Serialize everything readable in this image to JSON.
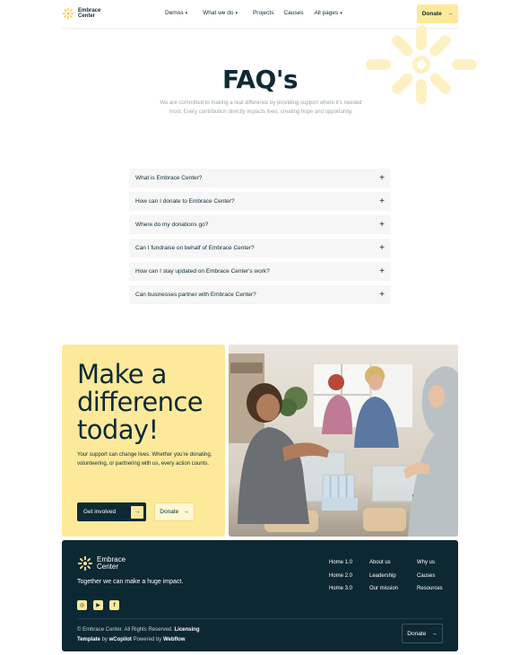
{
  "nav": {
    "logo_text": "Embrace Center",
    "menu": [
      {
        "label": "Demos",
        "caret": "▾"
      },
      {
        "label": "What we do",
        "caret": "▾"
      },
      {
        "label": "Projects",
        "caret": ""
      },
      {
        "label": "Causes",
        "caret": ""
      },
      {
        "label": "All pages",
        "caret": "▾"
      }
    ],
    "donate_label": "Donate",
    "arrow": "→"
  },
  "hero": {
    "title": "FAQ's",
    "subtitle": "We are committed to making a real difference by providing support where it's needed most. Every contribution directly impacts lives, creating hope and opportunity."
  },
  "faq": {
    "items": [
      {
        "question": "What is Embrace Center?"
      },
      {
        "question": "How can I donate to Embrace Center?"
      },
      {
        "question": "Where do my donations go?"
      },
      {
        "question": "Can I fundraise on behalf of Embrace Center?"
      },
      {
        "question": "How can I stay updated on Embrace Center's work?"
      },
      {
        "question": "Can businesses partner with Embrace Center?"
      }
    ],
    "expand_icon": "+"
  },
  "cta": {
    "heading_line1": "Make a",
    "heading_line2": "difference",
    "heading_line3": "today!",
    "text": "Your support can change lives. Whether you're donating, volunteering, or partnering with us, every action counts.",
    "primary_label": "Get involved",
    "secondary_label": "Donate",
    "arrow": "→"
  },
  "footer": {
    "logo_text": "Embrace Center",
    "tagline": "Together we can make a huge impact.",
    "social": [
      "instagram-icon",
      "youtube-icon",
      "facebook-icon"
    ],
    "col1": [
      "Home 1.0",
      "Home 2.0",
      "Home 3.0"
    ],
    "col2": [
      "About us",
      "Leadership",
      "Our mission"
    ],
    "col3": [
      "Why us",
      "Causes",
      "Resources"
    ],
    "copyright": "© Embrace Center. All Rights Reserved.",
    "licensing": "Licensing",
    "template_word": "Template",
    "by_word": "by",
    "wcopilot": "wCopilot",
    "powered_by": "Powered by",
    "webflow": "Webflow",
    "donate_label": "Donate",
    "arrow": "→"
  },
  "colors": {
    "accent_yellow": "#fde99a",
    "navy": "#0c2833",
    "text_dark": "#0e2a35"
  }
}
